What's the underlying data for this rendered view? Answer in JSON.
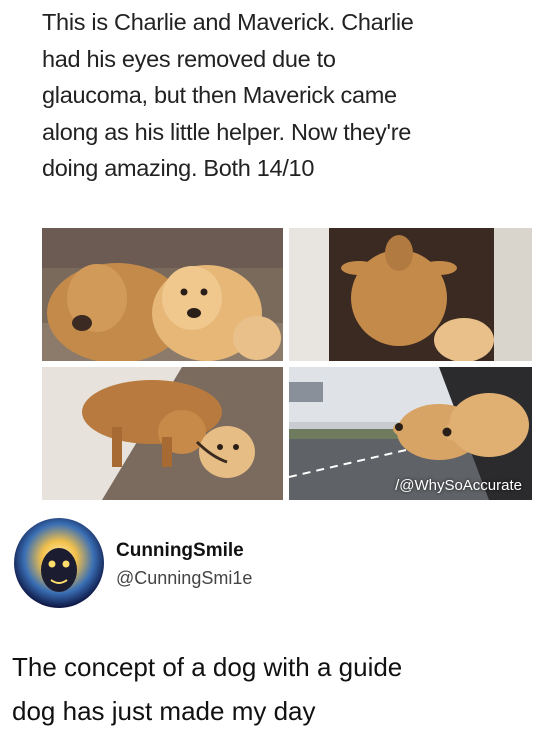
{
  "post": {
    "caption_lines": [
      "This is Charlie and Maverick. Charlie",
      "had his eyes removed due to",
      "glaucoma, but then Maverick came",
      "along as his little helper. Now they're",
      "doing amazing. Both 14/10"
    ],
    "photos": [
      {
        "icon": "two-golden-retrievers-on-couch-photo"
      },
      {
        "icon": "dogs-lying-on-floor-photo"
      },
      {
        "icon": "dog-leading-dog-on-leash-photo"
      },
      {
        "icon": "dogs-heads-out-car-window-photo"
      }
    ],
    "watermark": "/@WhySoAccurate"
  },
  "tweet": {
    "display_name": "CunningSmile",
    "handle": "@CunningSmi1e",
    "avatar_icon": "glowing-face-avatar-icon",
    "text_lines": [
      "The concept of a dog with a guide",
      "dog has just made my day"
    ]
  },
  "colors": {
    "text": "#222222",
    "background": "#ffffff",
    "handle": "#444444",
    "avatar_bg": "#1a2a6c"
  }
}
